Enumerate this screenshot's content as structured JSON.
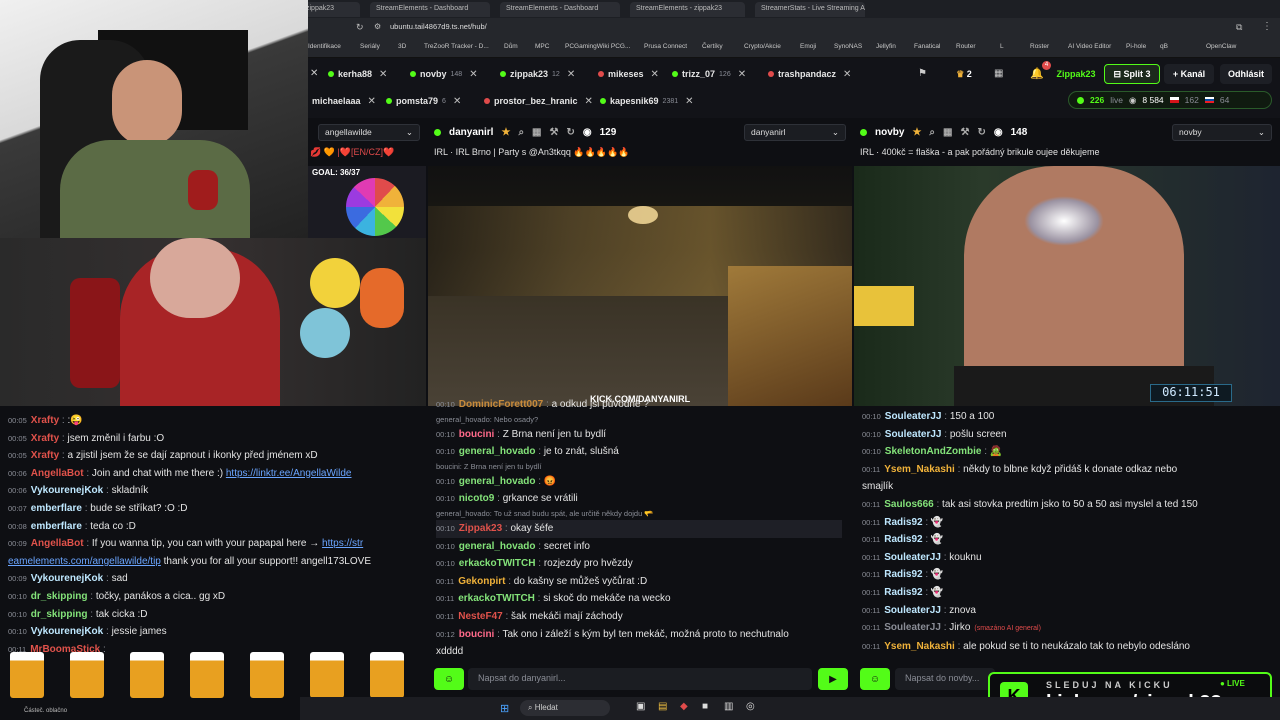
{
  "browser": {
    "tabs": [
      "zippak23",
      "StreamElements - Dashboard",
      "StreamElements - Dashboard",
      "StreamElements - zippak23",
      "StreamerStats - Live Streaming Ana"
    ],
    "url": "ubuntu.tail4867d9.ts.net/hub/",
    "bookmarks": [
      "Identifikace",
      "Seriály",
      "3D",
      "TreZooR Tracker - D...",
      "Dům",
      "MPC",
      "PCGamingWiki PCG...",
      "Prusa Connect",
      "Čertíky",
      "Crypto/Akcie",
      "Emoji",
      "SynoNAS",
      "Jellyfin",
      "Fanatical",
      "Router",
      "L",
      "Roster",
      "AI Video Editor",
      "Pi-hole",
      "qB",
      "OpenClaw"
    ]
  },
  "channels_row1": [
    {
      "name": "kerha88",
      "count": ""
    },
    {
      "name": "novby",
      "count": "148"
    },
    {
      "name": "zippak23",
      "count": "12"
    },
    {
      "name": "mikeses",
      "count": ""
    },
    {
      "name": "trizz_07",
      "count": "126"
    },
    {
      "name": "trashpandacz",
      "count": ""
    }
  ],
  "channels_row2": [
    {
      "name": "michaelaaa",
      "count": ""
    },
    {
      "name": "pomsta79",
      "count": "6"
    },
    {
      "name": "prostor_bez_hranic",
      "count": ""
    },
    {
      "name": "kapesnik69",
      "count": "2381"
    }
  ],
  "topright": {
    "crown_count": "2",
    "user": "Zippak23",
    "split": "Split 3",
    "add_channel": "+ Kanál",
    "logout": "Odhlásit",
    "live_count": "226",
    "live_label": "live",
    "viewers": "8 584",
    "cz_count": "162",
    "other_count": "64"
  },
  "panes": [
    {
      "channel": "angellawilde",
      "select": "angellawilde",
      "title": "💋 🧡 |❤️[EN/CZ]❤️",
      "goal": "GOAL: 36/37"
    },
    {
      "channel": "danyanirl",
      "viewers": "129",
      "select": "danyanirl",
      "title": "IRL · IRL Brno | Party s @An3tkqq 🔥🔥🔥🔥🔥",
      "watermark": "KICK.COM/DANYANIRL"
    },
    {
      "channel": "novby",
      "viewers": "148",
      "select": "novby",
      "title": "IRL · 400kč = flaška - a pak pořádný brikule oujee děkujeme",
      "clock": "06:11:51"
    }
  ],
  "chat_left": [
    {
      "ts": "00:05",
      "user": "Xrafty",
      "color": "#e0524b",
      "text": ":😜"
    },
    {
      "ts": "00:05",
      "user": "Xrafty",
      "color": "#e0524b",
      "text": "jsem změnil i farbu :O"
    },
    {
      "ts": "00:05",
      "user": "Xrafty",
      "color": "#e0524b",
      "text": "a zjistil jsem že se dají zapnout i ikonky před jménem xD"
    },
    {
      "ts": "00:06",
      "user": "AngellaBot",
      "color": "#e0524b",
      "text": "Join and chat with me there :) ",
      "link": "https://linktr.ee/AngellaWilde"
    },
    {
      "ts": "00:06",
      "user": "VykourenejKok",
      "color": "#bfe8ff",
      "text": "skladník"
    },
    {
      "ts": "00:07",
      "user": "emberflare",
      "color": "#bfe8ff",
      "text": "bude se stříkat? :O :D"
    },
    {
      "ts": "00:08",
      "user": "emberflare",
      "color": "#bfe8ff",
      "text": "teda co :D"
    },
    {
      "ts": "00:09",
      "user": "AngellaBot",
      "color": "#e0524b",
      "text": "If you wanna tip, you can with your papapal here → ",
      "link": "https://str"
    },
    {
      "ts": "",
      "user": "",
      "color": "#6aa5ff",
      "text": "",
      "link": "eamelements.com/angellawilde/tip",
      "tail": " thank you for all your support!! angell173LOVE"
    },
    {
      "ts": "00:09",
      "user": "VykourenejKok",
      "color": "#bfe8ff",
      "text": "sad"
    },
    {
      "ts": "00:10",
      "user": "dr_skipping",
      "color": "#84e37a",
      "text": "točky, panákos a cica.. gg xD"
    },
    {
      "ts": "00:10",
      "user": "dr_skipping",
      "color": "#84e37a",
      "text": "tak cicka :D"
    },
    {
      "ts": "00:10",
      "user": "VykourenejKok",
      "color": "#bfe8ff",
      "text": "jessie james"
    },
    {
      "ts": "00:11",
      "user": "MrBoomaStick",
      "color": "#e0524b",
      "text": ""
    }
  ],
  "chat_mid": [
    {
      "ts": "00:10",
      "user": "DominicForett007",
      "color": "#c88a3a",
      "text": "a odkud jsi původně ?"
    },
    {
      "reply": "general_hovado: Nebo osady?"
    },
    {
      "ts": "00:10",
      "user": "boucini",
      "color": "#ff6a8a",
      "text": "Z Brna není jen tu bydlí"
    },
    {
      "ts": "00:10",
      "user": "general_hovado",
      "color": "#84e37a",
      "text": "je to znát, slušná"
    },
    {
      "reply": "boucini: Z Brna není jen tu bydlí"
    },
    {
      "ts": "00:10",
      "user": "general_hovado",
      "color": "#84e37a",
      "text": "😡"
    },
    {
      "ts": "00:10",
      "user": "nicoto9",
      "color": "#84e37a",
      "text": "grkance se vrátili"
    },
    {
      "reply": "general_hovado: To už snad budu spát, ale určitě někdy dojdu 🫳"
    },
    {
      "ts": "00:10",
      "user": "Zippak23",
      "color": "#e0524b",
      "text": "okay šéfe"
    },
    {
      "ts": "00:10",
      "user": "general_hovado",
      "color": "#84e37a",
      "text": "secret info"
    },
    {
      "ts": "00:10",
      "user": "erkackoTWITCH",
      "color": "#84e37a",
      "text": "rozjezdy pro hvězdy"
    },
    {
      "ts": "00:11",
      "user": "Gekonpirt",
      "color": "#f0b23a",
      "text": "do kašny se můžeš vyčůrat :D"
    },
    {
      "ts": "00:11",
      "user": "erkackoTWITCH",
      "color": "#84e37a",
      "text": "si skoč do mekáče na wecko"
    },
    {
      "ts": "00:11",
      "user": "NesteF47",
      "color": "#e0524b",
      "text": "šak mekáči mají záchody"
    },
    {
      "ts": "00:12",
      "user": "boucini",
      "color": "#ff6a8a",
      "text": "Tak ono i záleží s kým byl ten mekáč, možná proto to nechutnalo"
    },
    {
      "ts": "",
      "user": "",
      "color": "#e4e4e4",
      "text": "xdddd"
    }
  ],
  "chat_right": [
    {
      "ts": "00:10",
      "user": "SouleaterJJ",
      "color": "#bfe8ff",
      "text": "150 a 100"
    },
    {
      "ts": "00:10",
      "user": "SouleaterJJ",
      "color": "#bfe8ff",
      "text": "pošlu screen"
    },
    {
      "ts": "00:10",
      "user": "SkeletonAndZombie",
      "color": "#84e37a",
      "text": "🧟"
    },
    {
      "ts": "00:11",
      "user": "Ysem_Nakashi",
      "color": "#f0b23a",
      "text": "někdy to blbne když přidáš k donate odkaz nebo"
    },
    {
      "ts": "",
      "user": "",
      "color": "#e4e4e4",
      "text": "smajlík"
    },
    {
      "ts": "00:11",
      "user": "Saulos666",
      "color": "#84e37a",
      "text": "tak asi stovka predtim jsko to 50 a 50 asi myslel a ted 150"
    },
    {
      "ts": "00:11",
      "user": "Radis92",
      "color": "#bfe8ff",
      "text": "👻"
    },
    {
      "ts": "00:11",
      "user": "Radis92",
      "color": "#bfe8ff",
      "text": "👻"
    },
    {
      "ts": "00:11",
      "user": "SouleaterJJ",
      "color": "#bfe8ff",
      "text": "kouknu"
    },
    {
      "ts": "00:11",
      "user": "Radis92",
      "color": "#bfe8ff",
      "text": "👻"
    },
    {
      "ts": "00:11",
      "user": "Radis92",
      "color": "#bfe8ff",
      "text": "👻"
    },
    {
      "ts": "00:11",
      "user": "SouleaterJJ",
      "color": "#bfe8ff",
      "text": "znova"
    },
    {
      "ts": "00:11",
      "user": "SouleaterJJ",
      "color": "#8a8d96",
      "text": "Jirko",
      "note": "(smazáno AI general)"
    },
    {
      "ts": "00:11",
      "user": "Ysem_Nakashi",
      "color": "#f0b23a",
      "text": "ale pokud se ti to neukázalo tak to nebylo odesláno"
    }
  ],
  "inputs": {
    "mid_placeholder": "Napsat do danyanirl...",
    "right_placeholder": "Napsat do novby..."
  },
  "overlay": {
    "follow_label": "SLEDUJ NA KICKU",
    "live_badge": "● LIVE",
    "url": "kick.com/zippak23"
  },
  "taskbar": {
    "search": "Hledat",
    "weather": "Částeč. oblačno"
  },
  "colors": {
    "kick_green": "#53fc18",
    "bg": "#0e0f13"
  }
}
